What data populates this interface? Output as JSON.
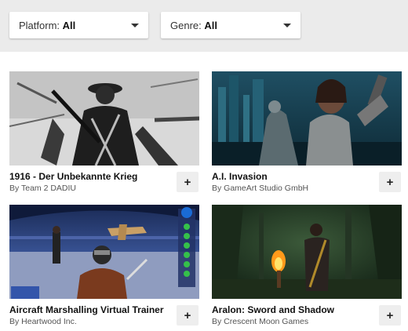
{
  "filters": {
    "platform": {
      "label": "Platform:",
      "value": "All",
      "icon": "caret-down-icon"
    },
    "genre": {
      "label": "Genre:",
      "value": "All",
      "icon": "caret-down-icon"
    }
  },
  "games": [
    {
      "title": "1916 - Der Unbekannte Krieg",
      "author": "By Team 2 DADIU",
      "add_label": "+"
    },
    {
      "title": "A.I. Invasion",
      "author": "By GameArt Studio GmbH",
      "add_label": "+"
    },
    {
      "title": "Aircraft Marshalling Virtual Trainer",
      "author": "By Heartwood Inc.",
      "add_label": "+"
    },
    {
      "title": "Aralon: Sword and Shadow",
      "author": "By Crescent Moon Games",
      "add_label": "+"
    }
  ],
  "colors": {
    "filter_bar": "#ebebeb",
    "add_button": "#eeeeee"
  }
}
